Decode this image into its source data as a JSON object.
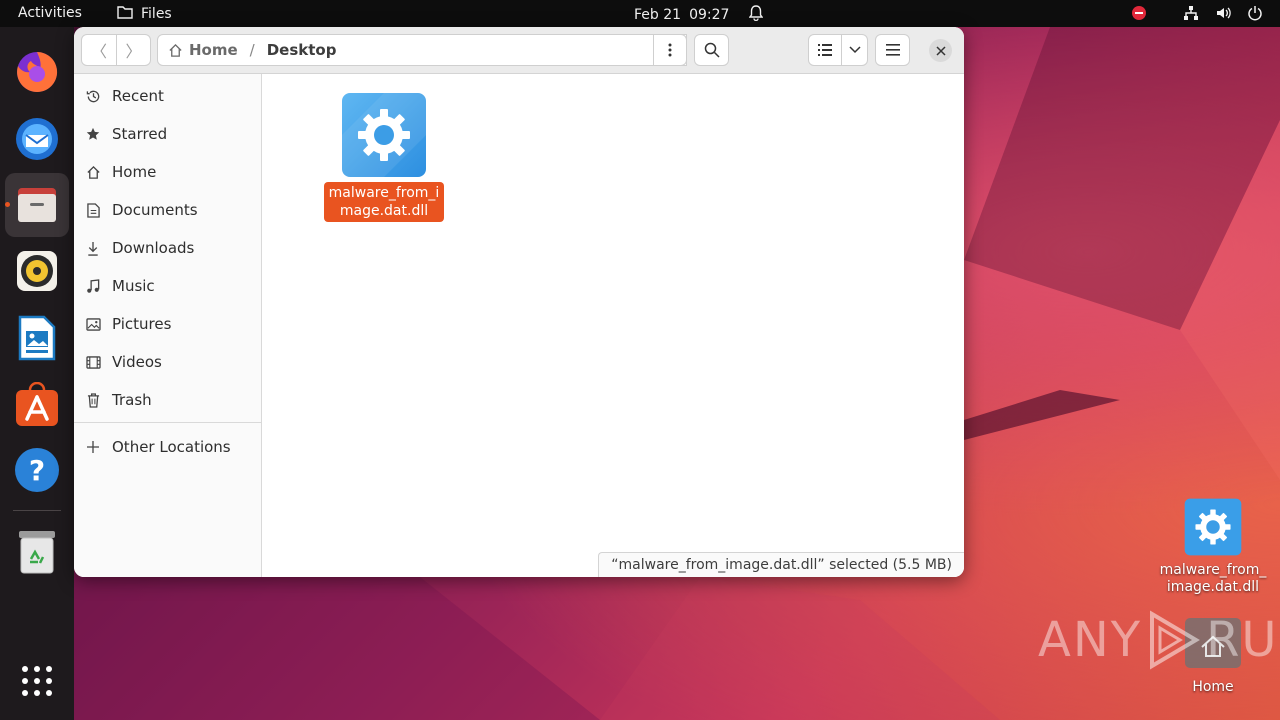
{
  "topbar": {
    "activities": "Activities",
    "app_name": "Files",
    "date": "Feb 21",
    "time": "09:27"
  },
  "dock": {
    "apps": [
      "firefox",
      "thunderbird",
      "files",
      "rhythmbox",
      "libreoffice-writer",
      "app-center",
      "help",
      "trash",
      "show-apps"
    ],
    "active_app": "files",
    "active_color": "#e95420"
  },
  "window": {
    "path_home": "Home",
    "path_separator": "/",
    "path_current": "Desktop",
    "sidebar": [
      {
        "label": "Recent",
        "icon": "clock-icon"
      },
      {
        "label": "Starred",
        "icon": "star-icon"
      },
      {
        "label": "Home",
        "icon": "home-icon"
      },
      {
        "label": "Documents",
        "icon": "document-icon"
      },
      {
        "label": "Downloads",
        "icon": "download-icon"
      },
      {
        "label": "Music",
        "icon": "music-icon"
      },
      {
        "label": "Pictures",
        "icon": "picture-icon"
      },
      {
        "label": "Videos",
        "icon": "video-icon"
      },
      {
        "label": "Trash",
        "icon": "trash-icon"
      }
    ],
    "other_locations": "Other Locations",
    "file": {
      "name": "malware_from_image.dat.dll",
      "icon": "settings-file-icon"
    },
    "status": "“malware_from_image.dat.dll” selected (5.5 MB)",
    "selection_color": "#e95420"
  },
  "desktop": {
    "file_label": "malware_from_image.dat.dll",
    "home_label": "Home"
  },
  "watermark": {
    "left": "ANY",
    "right": "RUN"
  }
}
